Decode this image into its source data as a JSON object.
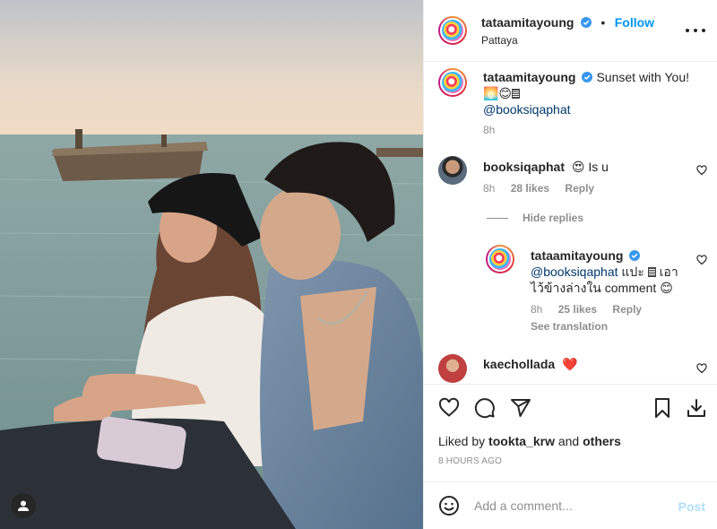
{
  "post": {
    "author": "tataamitayoung",
    "follow_label": "Follow",
    "dot": "•",
    "location": "Pattaya"
  },
  "caption": {
    "username": "tataamitayoung",
    "text": "Sunset with You!",
    "emoji_line": "🌅😊",
    "mention": "@booksiqaphat",
    "time": "8h"
  },
  "comments": [
    {
      "username": "booksiqaphat",
      "text": "😍 Is u",
      "time": "8h",
      "likes": "28 likes",
      "reply": "Reply"
    }
  ],
  "hide_replies": "Hide replies",
  "reply": {
    "username": "tataamitayoung",
    "mention": "@booksiqaphat",
    "text_a": "แปะ",
    "text_b": "เอาไว้ข้างล่างใน comment 😊",
    "time": "8h",
    "likes": "25 likes",
    "reply": "Reply",
    "see_translation": "See translation"
  },
  "next_comment": {
    "username": "kaechollada",
    "text": "❤️"
  },
  "liked_by": {
    "prefix": "Liked by",
    "user": "tookta_krw",
    "and": "and",
    "others": "others"
  },
  "timestamp": "8 HOURS AGO",
  "add_comment": {
    "placeholder": "Add a comment...",
    "post_label": "Post"
  },
  "icons": {
    "verified": "verified-badge-icon",
    "more": "more-options-icon",
    "like": "heart-icon",
    "comment": "comment-bubble-icon",
    "share": "paper-plane-icon",
    "save": "bookmark-icon",
    "download": "download-icon",
    "emoji": "emoji-smile-icon",
    "user_tag": "user-tag-icon"
  },
  "colors": {
    "link_blue": "#0095f6",
    "mention_blue": "#00376b",
    "secondary_text": "#8e8e8e",
    "post_disabled": "#b2dffc",
    "verified_blue": "#3897f0"
  }
}
